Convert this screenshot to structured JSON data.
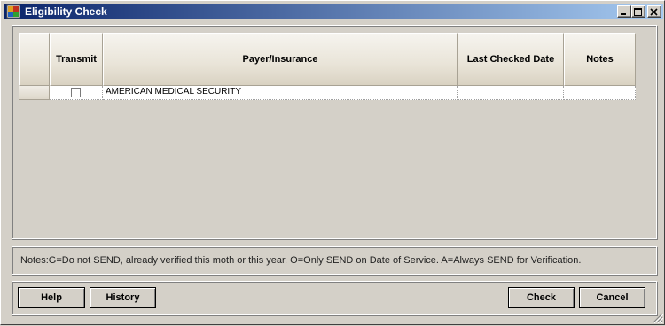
{
  "window": {
    "title": "Eligibility Check"
  },
  "grid": {
    "columns": [
      "Transmit",
      "Payer/Insurance",
      "Last Checked Date",
      "Notes"
    ],
    "rows": [
      {
        "transmit": false,
        "payer": "AMERICAN MEDICAL SECURITY",
        "last_checked": "",
        "notes": ""
      }
    ]
  },
  "notes_text": "Notes:G=Do not SEND, already verified this moth or this year. O=Only SEND on Date of Service. A=Always SEND for Verification.",
  "buttons": {
    "help": "Help",
    "history": "History",
    "check": "Check",
    "cancel": "Cancel"
  },
  "colors": {
    "title_bar_start": "#0a246a",
    "title_bar_end": "#a6caf0",
    "window_bg": "#d4d0c8"
  },
  "icons": {
    "app": "app-icon",
    "minimize": "minimize-icon",
    "maximize": "maximize-icon",
    "close": "close-icon",
    "resize": "resize-grip-icon"
  }
}
